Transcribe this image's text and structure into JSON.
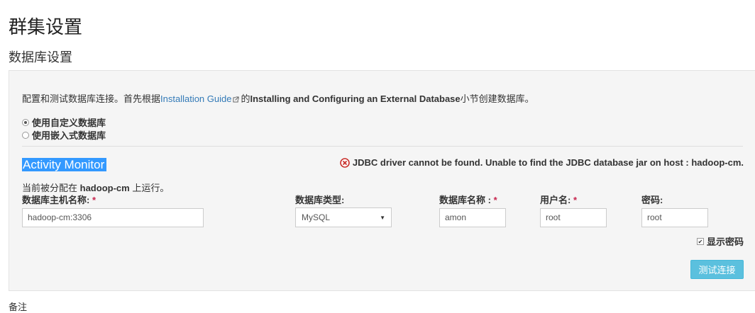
{
  "page": {
    "title": "群集设置",
    "section_title": "数据库设置"
  },
  "intro": {
    "prefix": "配置和测试数据库连接。首先根据",
    "link_text": "Installation Guide",
    "middle": "的",
    "bold_text": "Installing and Configuring an External Database",
    "suffix": "小节创建数据库。"
  },
  "db_mode": {
    "options": [
      {
        "label": "使用自定义数据库",
        "checked": true
      },
      {
        "label": "使用嵌入式数据库",
        "checked": false
      }
    ]
  },
  "role": {
    "title": "Activity Monitor",
    "error_message": "JDBC driver cannot be found. Unable to find the JDBC database jar on host : hadoop-cm.",
    "assigned_prefix": "当前被分配在",
    "assigned_host": "hadoop-cm",
    "assigned_suffix": "上运行。"
  },
  "fields": {
    "host_label": "数据库主机名称:",
    "host_value": "hadoop-cm:3306",
    "type_label": "数据库类型:",
    "type_value": "MySQL",
    "name_label": "数据库名称 :",
    "name_value": "amon",
    "user_label": "用户名:",
    "user_value": "root",
    "password_label": "密码:",
    "password_value": "root",
    "required_mark": "*"
  },
  "show_password": {
    "label": "显示密码",
    "checked": true
  },
  "test_button": {
    "label": "测试连接"
  },
  "notes_label": "备注"
}
